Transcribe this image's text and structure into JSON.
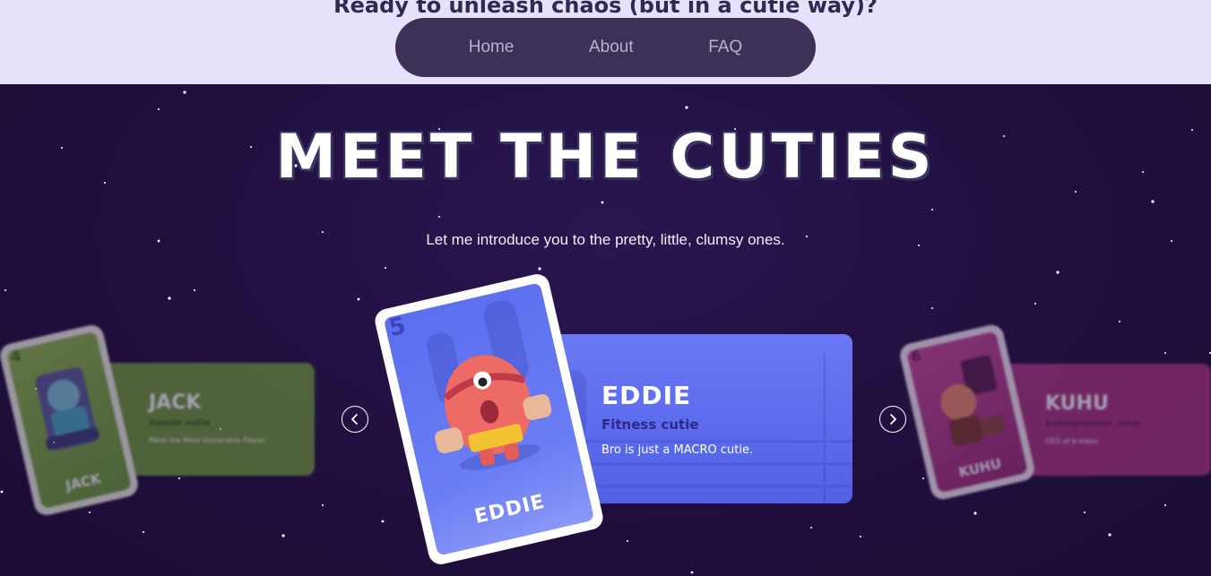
{
  "top": {
    "heading": "Ready to unleash chaos (but in a cutie way)?"
  },
  "nav": {
    "items": [
      {
        "label": "Home"
      },
      {
        "label": "About"
      },
      {
        "label": "FAQ"
      }
    ]
  },
  "section": {
    "title": "MEET THE CUTIES",
    "subtitle": "Let me introduce you to the pretty, little, clumsy ones."
  },
  "carousel": {
    "prev_icon": "chevron-left-icon",
    "next_icon": "chevron-right-icon",
    "cards": [
      {
        "number": "4",
        "name": "JACK",
        "role": "Gamer cutie",
        "description": "Meet the Most Vulnerable Player.",
        "color": "#6f9a3a"
      },
      {
        "number": "5",
        "name": "EDDIE",
        "role": "Fitness cutie",
        "description": "Bro is just a MACRO cutie.",
        "color": "#5b6cf0"
      },
      {
        "number": "6",
        "name": "KUHU",
        "role": "Entrepreneur cutie",
        "description": "CEO of a mess.",
        "color": "#a8377f"
      }
    ]
  },
  "colors": {
    "top_band": "#e6e2fb",
    "navbar": "#3d3158",
    "space": "#200f3e",
    "accent_blue": "#5b6cf0",
    "eddie_role": "#2b2a8a"
  }
}
